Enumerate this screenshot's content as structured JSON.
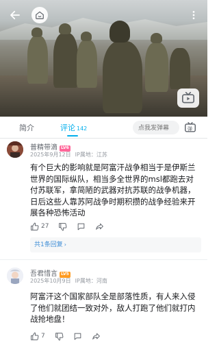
{
  "video": {
    "back_icon": "arrow-left-icon",
    "home_icon": "home-icon",
    "more_icon": "more-vertical-icon",
    "play_icon": "tv-icon"
  },
  "tabs": {
    "intro_label": "简介",
    "comments_label": "评论",
    "comments_count": "142",
    "danmaku_placeholder": "点我发弹幕",
    "danmaku_toggle_label": "弹"
  },
  "comments": [
    {
      "username": "普精带滴",
      "level": "LV6",
      "level_color": "#ff6699",
      "date": "2025年9月12日",
      "ip": "IP属地：江苏",
      "text": "有个巨大的影响就是阿富汗战争相当于是伊斯兰世界的国际纵队，相当多全世界的msl都跑去对付苏联军，拿简陋的武器对抗苏联的战争机器，日后这些人靠苏阿战争时期积攒的战争经验来开展各种恐怖活动",
      "likes": "27",
      "reply_label": "共1条回复"
    },
    {
      "username": "吾君惜言",
      "level": "LV5",
      "level_color": "#ff9b21",
      "date": "2025年10月9日",
      "ip": "IP属地：河南",
      "text": "阿富汗这个国家部队全是部落性质，有人来入侵了他们就团结一致对外，敌人打跑了他们就打内战抢地盘！",
      "likes": "7"
    }
  ]
}
